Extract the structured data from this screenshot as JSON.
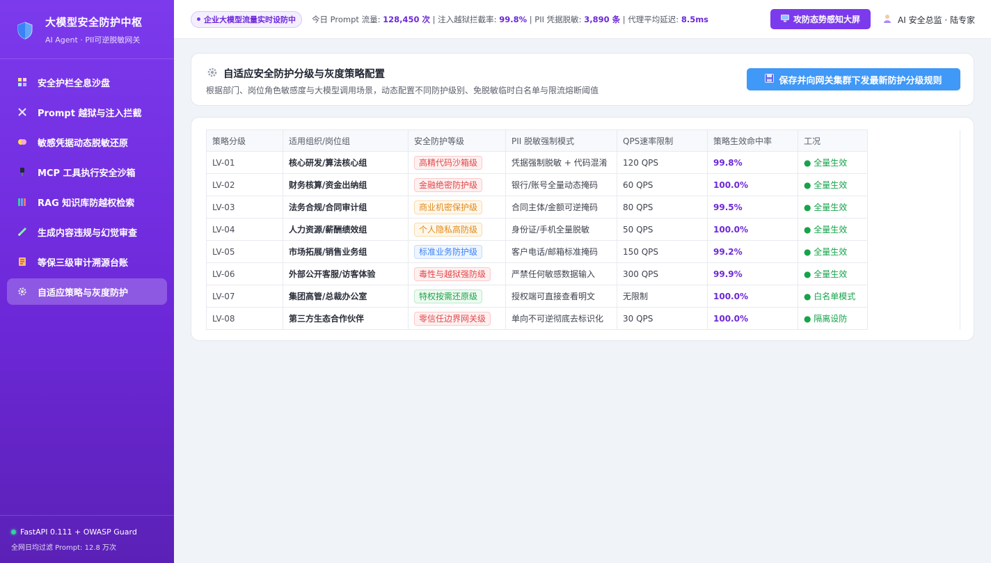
{
  "sidebar": {
    "brand_title": "大模型安全防护中枢",
    "brand_subtitle": "AI Agent · PII可逆脱敏网关",
    "logo_icon": "shield-icon",
    "items": [
      {
        "label": "安全护栏全息沙盘",
        "icon": "dashboard-icon"
      },
      {
        "label": "Prompt 越狱与注入拦截",
        "icon": "crossed-swords-icon"
      },
      {
        "label": "敏感凭据动态脱敏还原",
        "icon": "mask-icon"
      },
      {
        "label": "MCP 工具执行安全沙箱",
        "icon": "plug-icon"
      },
      {
        "label": "RAG 知识库防越权检索",
        "icon": "books-icon"
      },
      {
        "label": "生成内容违规与幻觉审查",
        "icon": "pencil-icon"
      },
      {
        "label": "等保三级审计溯源台账",
        "icon": "scroll-icon"
      },
      {
        "label": "自适应策略与灰度防护",
        "icon": "gear-icon"
      }
    ],
    "active_index": 7,
    "footer": {
      "status": "FastAPI 0.111 + OWASP Guard",
      "stats": "全网日均过滤 Prompt: 12.8 万次"
    }
  },
  "topbar": {
    "live_badge": "企业大模型流量实时设防中",
    "metric_prefix_1": "今日 Prompt 流量: ",
    "metric_value_1": "128,450 次",
    "metric_prefix_2": " | 注入越狱拦截率: ",
    "metric_value_2": "99.8%",
    "metric_prefix_3": " | PII 凭据脱敏: ",
    "metric_value_3": "3,890 条",
    "metric_prefix_4": " | 代理平均延迟: ",
    "metric_value_4": "8.5ms",
    "screen_button": "攻防态势感知大屏",
    "user": "AI 安全总监 · 陆专家"
  },
  "header": {
    "title": "自适应安全防护分级与灰度策略配置",
    "description": "根据部门、岗位角色敏感度与大模型调用场景，动态配置不同防护级别、免脱敏临时白名单与限流熔断阈值",
    "save_button": "保存并向网关集群下发最新防护分级规则"
  },
  "table": {
    "columns": [
      "策略分级",
      "适用组织/岗位组",
      "安全防护等级",
      "PII 脱敏强制模式",
      "QPS速率限制",
      "策略生效命中率",
      "工况"
    ],
    "rows": [
      {
        "id": "LV-01",
        "org": "核心研发/算法核心组",
        "level": "高精代码沙箱级",
        "level_color": "red",
        "mode": "凭据强制脱敏 + 代码混淆",
        "qps": "120 QPS",
        "rate": "99.8%",
        "status": "● 全量生效"
      },
      {
        "id": "LV-02",
        "org": "财务核算/资金出纳组",
        "level": "金融绝密防护级",
        "level_color": "red",
        "mode": "银行/账号全量动态掩码",
        "qps": "60 QPS",
        "rate": "100.0%",
        "status": "● 全量生效"
      },
      {
        "id": "LV-03",
        "org": "法务合规/合同审计组",
        "level": "商业机密保护级",
        "level_color": "orange",
        "mode": "合同主体/金额可逆掩码",
        "qps": "80 QPS",
        "rate": "99.5%",
        "status": "● 全量生效"
      },
      {
        "id": "LV-04",
        "org": "人力资源/薪酬绩效组",
        "level": "个人隐私高防级",
        "level_color": "orange",
        "mode": "身份证/手机全量脱敏",
        "qps": "50 QPS",
        "rate": "100.0%",
        "status": "● 全量生效"
      },
      {
        "id": "LV-05",
        "org": "市场拓展/销售业务组",
        "level": "标准业务防护级",
        "level_color": "blue",
        "mode": "客户电话/邮箱标准掩码",
        "qps": "150 QPS",
        "rate": "99.2%",
        "status": "● 全量生效"
      },
      {
        "id": "LV-06",
        "org": "外部公开客服/访客体验",
        "level": "毒性与越狱强防级",
        "level_color": "red",
        "mode": "严禁任何敏感数据输入",
        "qps": "300 QPS",
        "rate": "99.9%",
        "status": "● 全量生效"
      },
      {
        "id": "LV-07",
        "org": "集团高管/总裁办公室",
        "level": "特权按需还原级",
        "level_color": "green",
        "mode": "授权端可直接查看明文",
        "qps": "无限制",
        "rate": "100.0%",
        "status": "● 白名单模式"
      },
      {
        "id": "LV-08",
        "org": "第三方生态合作伙伴",
        "level": "零信任边界网关级",
        "level_color": "red",
        "mode": "单向不可逆彻底去标识化",
        "qps": "30 QPS",
        "rate": "100.0%",
        "status": "● 隔离设防"
      }
    ]
  },
  "colors": {
    "accent": "#7c3aed",
    "save_button": "#4098f7",
    "status_green": "#16a34a",
    "tag_red": "#e0484b",
    "tag_orange": "#e08a1c",
    "tag_blue": "#3b82f6",
    "tag_green": "#22a04a"
  }
}
